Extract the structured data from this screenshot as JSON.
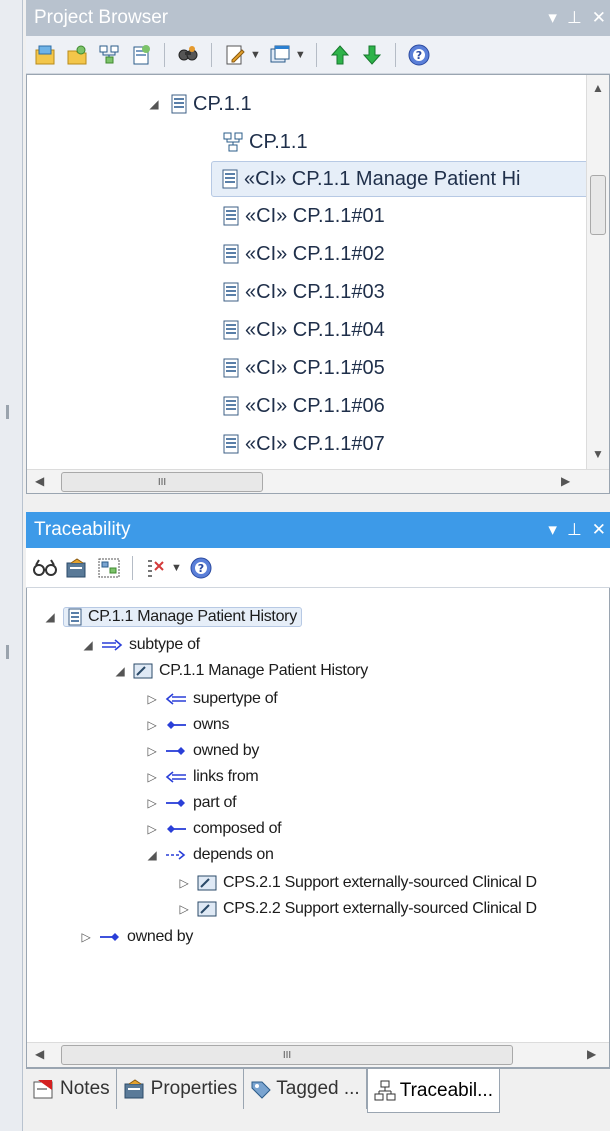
{
  "project_browser": {
    "title": "Project Browser",
    "window_buttons": [
      "▾",
      "ꟸ",
      "✕"
    ],
    "tree": [
      {
        "label": "CP.1.1",
        "icon": "class-icon",
        "expander": "◢",
        "level": 1
      },
      {
        "label": "CP.1.1",
        "icon": "diagram-icon",
        "expander": "",
        "level": 2
      },
      {
        "label": "«CI» CP.1.1 Manage Patient Hi",
        "icon": "class-icon",
        "expander": "",
        "level": 2,
        "selected": true
      },
      {
        "label": "«CI» CP.1.1#01",
        "icon": "class-icon",
        "expander": "",
        "level": 2
      },
      {
        "label": "«CI» CP.1.1#02",
        "icon": "class-icon",
        "expander": "",
        "level": 2
      },
      {
        "label": "«CI» CP.1.1#03",
        "icon": "class-icon",
        "expander": "",
        "level": 2
      },
      {
        "label": "«CI» CP.1.1#04",
        "icon": "class-icon",
        "expander": "",
        "level": 2
      },
      {
        "label": "«CI» CP.1.1#05",
        "icon": "class-icon",
        "expander": "",
        "level": 2
      },
      {
        "label": "«CI» CP.1.1#06",
        "icon": "class-icon",
        "expander": "",
        "level": 2
      },
      {
        "label": "«CI» CP.1.1#07",
        "icon": "class-icon",
        "expander": "",
        "level": 2
      }
    ],
    "hscroll_mark": "III"
  },
  "traceability": {
    "title": "Traceability",
    "window_buttons": [
      "▾",
      "ꟸ",
      "✕"
    ],
    "tree": [
      {
        "label": "CP.1.1 Manage Patient History",
        "icon": "class-icon",
        "expander": "◢",
        "level": 0,
        "selected": true
      },
      {
        "label": "subtype of",
        "icon": "generalization-arrow-icon",
        "expander": "◢",
        "level": 1
      },
      {
        "label": "CP.1.1 Manage Patient History",
        "icon": "requirement-icon",
        "expander": "◢",
        "level": 2
      },
      {
        "label": "supertype of",
        "icon": "left-arrow-icon",
        "expander": "▷",
        "level": 3
      },
      {
        "label": "owns",
        "icon": "owns-icon",
        "expander": "▷",
        "level": 3
      },
      {
        "label": "owned by",
        "icon": "owned-by-icon",
        "expander": "▷",
        "level": 3
      },
      {
        "label": "links from",
        "icon": "left-arrow-icon",
        "expander": "▷",
        "level": 3
      },
      {
        "label": "part of",
        "icon": "owned-by-icon",
        "expander": "▷",
        "level": 3
      },
      {
        "label": "composed of",
        "icon": "owns-icon",
        "expander": "▷",
        "level": 3
      },
      {
        "label": "depends on",
        "icon": "dependency-icon",
        "expander": "◢",
        "level": 3
      },
      {
        "label": "CPS.2.1 Support externally-sourced Clinical D",
        "icon": "requirement-icon",
        "expander": "▷",
        "level": 4
      },
      {
        "label": "CPS.2.2 Support externally-sourced Clinical D",
        "icon": "requirement-icon",
        "expander": "▷",
        "level": 4
      },
      {
        "label": "owned by",
        "icon": "owned-by-icon",
        "expander": "▷",
        "level": 1
      }
    ],
    "hscroll_mark": "III"
  },
  "bottom_tabs": [
    {
      "label": "Notes",
      "icon": "notes-icon"
    },
    {
      "label": "Properties",
      "icon": "properties-icon"
    },
    {
      "label": "Tagged ...",
      "icon": "tag-icon"
    },
    {
      "label": "Traceabil...",
      "icon": "traceability-icon",
      "active": true
    }
  ],
  "colors": {
    "active_title": "#3d9ae8",
    "inactive_title": "#b8c2ce"
  }
}
